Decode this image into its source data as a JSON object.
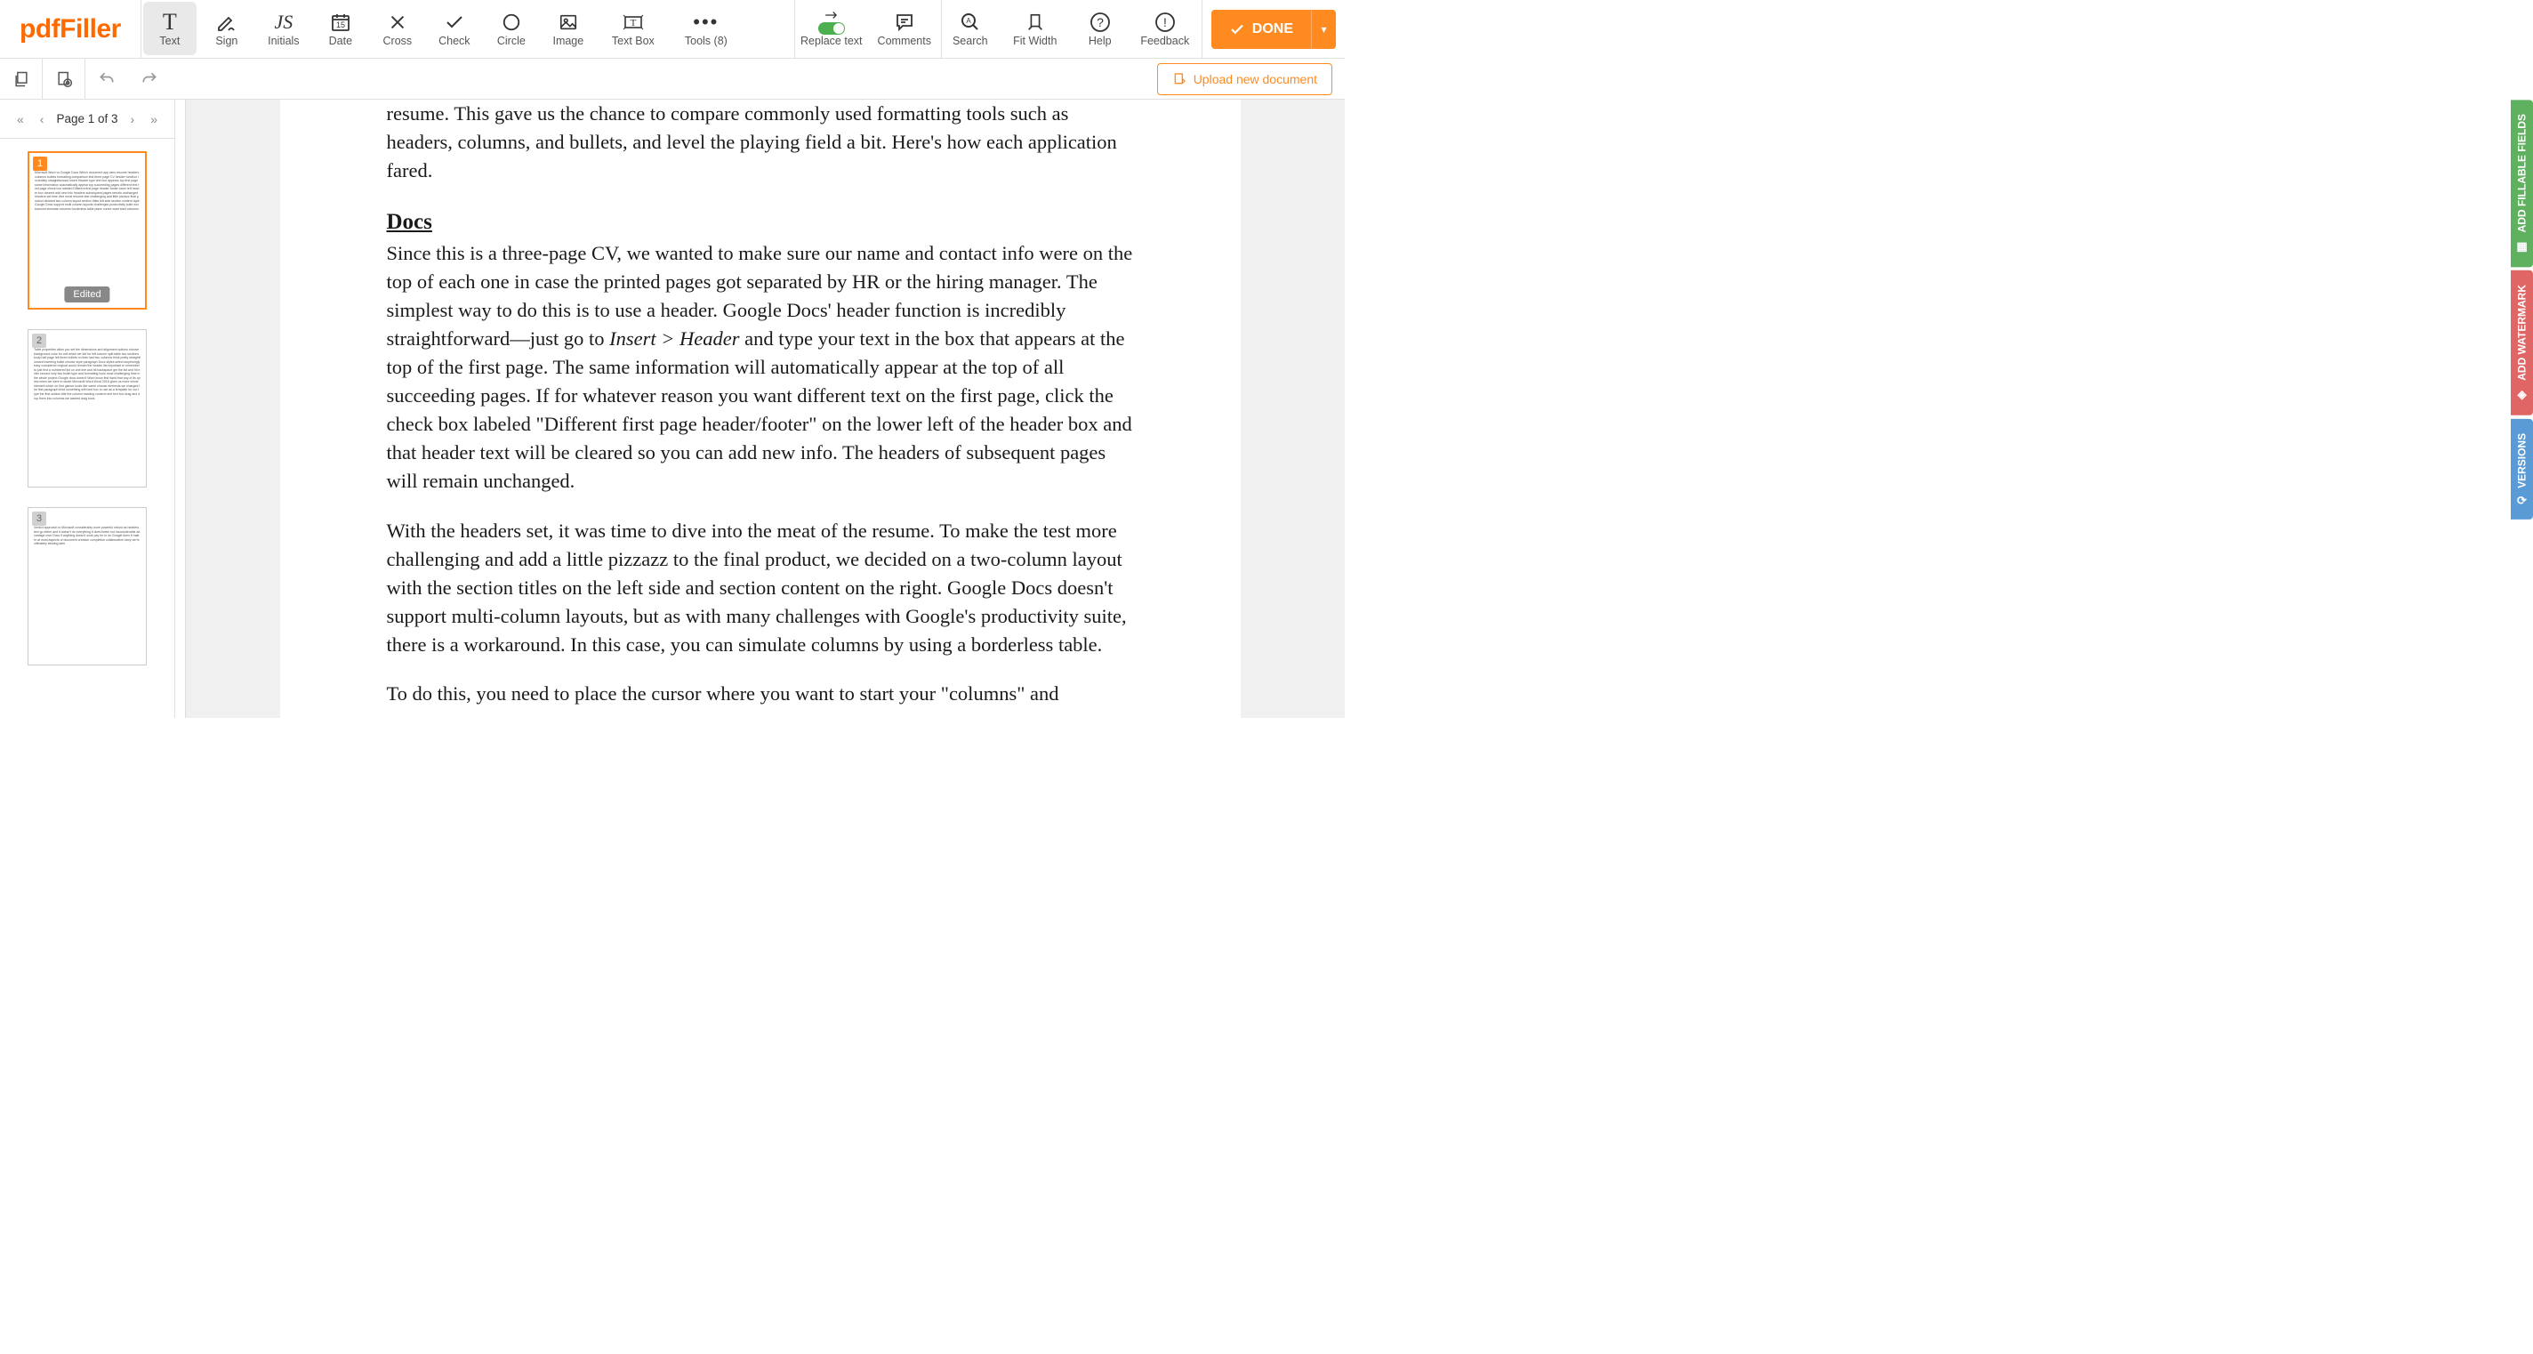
{
  "app": {
    "logo": "pdfFiller"
  },
  "toolbar": {
    "items": [
      {
        "id": "text",
        "label": "Text",
        "icon": "T",
        "active": true
      },
      {
        "id": "sign",
        "label": "Sign",
        "icon": "sign"
      },
      {
        "id": "initials",
        "label": "Initials",
        "icon": "JS"
      },
      {
        "id": "date",
        "label": "Date",
        "icon": "date"
      },
      {
        "id": "cross",
        "label": "Cross",
        "icon": "cross"
      },
      {
        "id": "check",
        "label": "Check",
        "icon": "check"
      },
      {
        "id": "circle",
        "label": "Circle",
        "icon": "circle"
      },
      {
        "id": "image",
        "label": "Image",
        "icon": "image"
      },
      {
        "id": "textbox",
        "label": "Text Box",
        "icon": "textbox"
      },
      {
        "id": "tools",
        "label": "Tools (8)",
        "icon": "dots"
      }
    ],
    "right1": [
      {
        "id": "replace",
        "label": "Replace text",
        "icon": "toggle"
      },
      {
        "id": "comments",
        "label": "Comments",
        "icon": "comment"
      }
    ],
    "right2": [
      {
        "id": "search",
        "label": "Search",
        "icon": "search"
      },
      {
        "id": "fitwidth",
        "label": "Fit Width",
        "icon": "fit"
      },
      {
        "id": "help",
        "label": "Help",
        "icon": "help"
      },
      {
        "id": "feedback",
        "label": "Feedback",
        "icon": "feedback"
      }
    ],
    "done": "DONE"
  },
  "subbar": {
    "upload": "Upload new document"
  },
  "sidebar": {
    "page_label": "Page 1 of 3",
    "thumbs": [
      {
        "num": "1",
        "edited": "Edited",
        "active": true
      },
      {
        "num": "2",
        "active": false
      },
      {
        "num": "3",
        "active": false
      }
    ]
  },
  "doc": {
    "p1": "resume. This gave us the chance to compare commonly used formatting tools such as headers, columns, and bullets, and level the playing field a bit. Here's how each application fared.",
    "h1": "Docs",
    "p2a": "Since this is a three-page CV, we wanted to make sure our name and contact info were on the top of each one in case the printed pages got separated by HR or the hiring manager. The simplest way to do this is to use a header. Google Docs' header function is incredibly straightforward—just go to ",
    "p2i": "Insert > Header",
    "p2b": " and type your text in the box that appears at the top of the first page. The same information will automatically appear at the top of all succeeding pages. If for whatever reason you want different text on the first page, click the check box labeled \"Different first page header/footer\" on the lower left of the header box and that header text will be cleared so you can add new info. The headers of subsequent pages will remain unchanged.",
    "p3": "With the headers set, it was time to dive into the meat of the resume. To make the test more challenging and add a little pizzazz to the final product, we decided on a two-column layout with the section titles on the left side and section content on the right. Google Docs doesn't support multi-column layouts, but as with many challenges with Google's productivity suite, there is a workaround. In this case, you can simulate columns by using a borderless table.",
    "p4": "To do this, you need to place the cursor where you want to start your \"columns\" and"
  },
  "side_tabs": {
    "fillable": "ADD FILLABLE FIELDS",
    "watermark": "ADD WATERMARK",
    "versions": "VERSIONS"
  }
}
